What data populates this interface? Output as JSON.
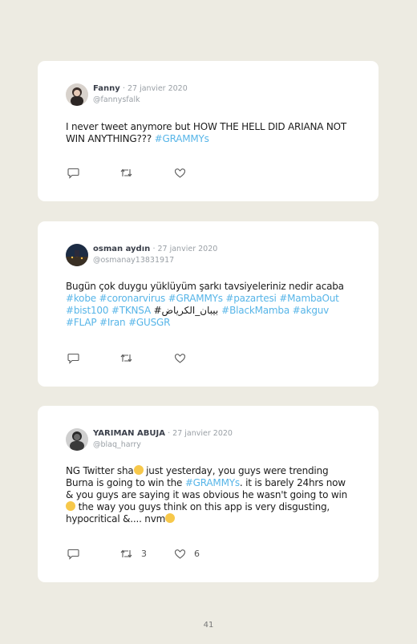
{
  "tweets": [
    {
      "name": "Fanny",
      "date": "· 27 janvier 2020",
      "handle": "@fannysfalk",
      "text_before": "I never tweet anymore but HOW THE HELL DID ARIANA NOT WIN ANYTHING??? ",
      "hashtags": "#GRAMMYs",
      "retweets": "",
      "likes": ""
    },
    {
      "name": "osman aydın",
      "date": "· 27 janvier 2020",
      "handle": "@osmanay13831917",
      "text_before": "Bugün çok duygu yüklüyüm şarkı tavsiyeleriniz nedir acaba ",
      "hashtags_1": "#kobe #coronarvirus #GRAMMYs #pazartesi #MambaOut #bist100 #TKNSA",
      "text_mid": " #بيبان_الكرياض ",
      "hashtags_2": "#BlackMamba #akguv #FLAP #Iran #GUSGR",
      "retweets": "",
      "likes": ""
    },
    {
      "name": "YARIMAN ABUJA",
      "date": "· 27 janvier 2020",
      "handle": "@blaq_harry",
      "text_1": "NG Twitter sha",
      "text_2": " just yesterday, you guys were trending Burna is going to win the ",
      "hashtag": "#GRAMMYs",
      "text_3": ". it is barely 24hrs now & you guys are saying it was obvious he wasn't going to win",
      "text_4": " the way you guys think on this app is very disgusting, hypocritical &.... nvm",
      "retweets": "3",
      "likes": "6"
    }
  ],
  "icons": {
    "reply": "reply-icon",
    "retweet": "retweet-icon",
    "like": "heart-icon"
  },
  "page_number": "41"
}
